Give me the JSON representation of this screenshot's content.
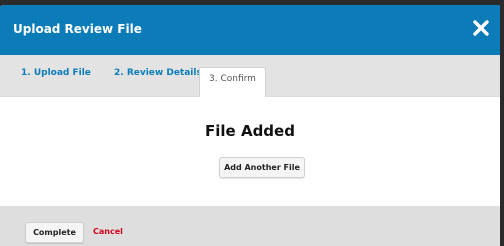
{
  "header": {
    "title": "Upload Review File",
    "close_icon": "close-icon"
  },
  "tabs": [
    {
      "label": "1. Upload File"
    },
    {
      "label": "2. Review Details"
    },
    {
      "label": "3. Confirm",
      "active": true
    }
  ],
  "main": {
    "heading": "File Added",
    "add_another_label": "Add Another File"
  },
  "footer": {
    "complete_label": "Complete",
    "cancel_label": "Cancel"
  },
  "colors": {
    "header_bg": "#0b7cb8",
    "tab_link": "#0b7cb8",
    "cancel": "#d0021b",
    "footer_bg": "#dedede"
  }
}
